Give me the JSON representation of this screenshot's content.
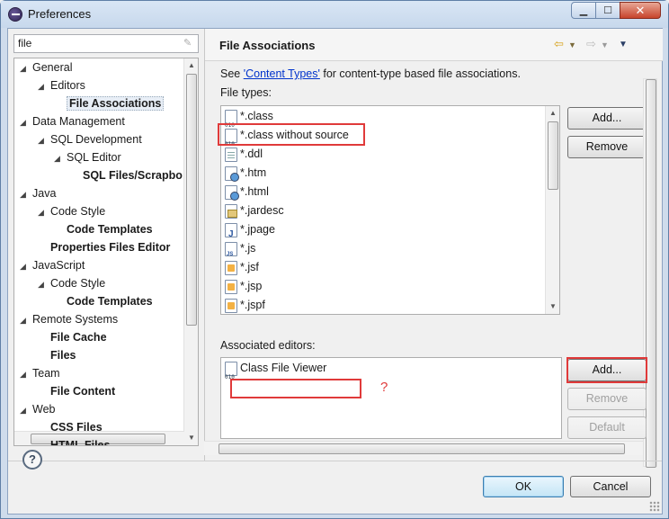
{
  "window": {
    "title": "Preferences"
  },
  "filter": {
    "value": "file"
  },
  "tree": [
    {
      "label": "General",
      "level": 0,
      "expanded": true,
      "bold": false
    },
    {
      "label": "Editors",
      "level": 1,
      "expanded": true,
      "bold": false
    },
    {
      "label": "File Associations",
      "level": 2,
      "bold": true,
      "selected": true
    },
    {
      "label": "Data Management",
      "level": 0,
      "expanded": true,
      "bold": false
    },
    {
      "label": "SQL Development",
      "level": 1,
      "expanded": true,
      "bold": false
    },
    {
      "label": "SQL Editor",
      "level": 2,
      "expanded": true,
      "bold": false
    },
    {
      "label": "SQL Files/Scrapbo",
      "level": 3,
      "bold": true
    },
    {
      "label": "Java",
      "level": 0,
      "expanded": true,
      "bold": false
    },
    {
      "label": "Code Style",
      "level": 1,
      "expanded": true,
      "bold": false
    },
    {
      "label": "Code Templates",
      "level": 2,
      "bold": true
    },
    {
      "label": "Properties Files Editor",
      "level": 1,
      "bold": true
    },
    {
      "label": "JavaScript",
      "level": 0,
      "expanded": true,
      "bold": false
    },
    {
      "label": "Code Style",
      "level": 1,
      "expanded": true,
      "bold": false
    },
    {
      "label": "Code Templates",
      "level": 2,
      "bold": true
    },
    {
      "label": "Remote Systems",
      "level": 0,
      "expanded": true,
      "bold": false
    },
    {
      "label": "File Cache",
      "level": 1,
      "bold": true
    },
    {
      "label": "Files",
      "level": 1,
      "bold": true
    },
    {
      "label": "Team",
      "level": 0,
      "expanded": true,
      "bold": false
    },
    {
      "label": "File Content",
      "level": 1,
      "bold": true
    },
    {
      "label": "Web",
      "level": 0,
      "expanded": true,
      "bold": false
    },
    {
      "label": "CSS Files",
      "level": 1,
      "bold": true
    },
    {
      "label": "HTML Files",
      "level": 1,
      "bold": true
    }
  ],
  "page": {
    "title": "File Associations",
    "info_prefix": "See ",
    "info_link": "'Content Types'",
    "info_suffix": " for content-type based file associations.",
    "file_types_label": "File types:",
    "associated_editors_label": "Associated editors:"
  },
  "file_types": [
    {
      "label": "*.class",
      "icon": "bin"
    },
    {
      "label": "*.class without source",
      "icon": "bin"
    },
    {
      "label": "*.ddl",
      "icon": "doc"
    },
    {
      "label": "*.htm",
      "icon": "globe"
    },
    {
      "label": "*.html",
      "icon": "globe"
    },
    {
      "label": "*.jardesc",
      "icon": "jar"
    },
    {
      "label": "*.jpage",
      "icon": "j"
    },
    {
      "label": "*.js",
      "icon": "js"
    },
    {
      "label": "*.jsf",
      "icon": "jsp"
    },
    {
      "label": "*.jsp",
      "icon": "jsp"
    },
    {
      "label": "*.jspf",
      "icon": "jsp"
    }
  ],
  "editors": [
    {
      "label": "Class File Viewer",
      "icon": "bin"
    }
  ],
  "buttons": {
    "types_add": "Add...",
    "types_remove": "Remove",
    "editors_add": "Add...",
    "editors_remove": "Remove",
    "editors_default": "Default",
    "ok": "OK",
    "cancel": "Cancel"
  },
  "annotation": {
    "question_mark": "?"
  },
  "icons": {
    "help": "help-icon",
    "back": "back-arrow-icon",
    "forward": "forward-arrow-icon",
    "menu": "view-menu-icon"
  }
}
